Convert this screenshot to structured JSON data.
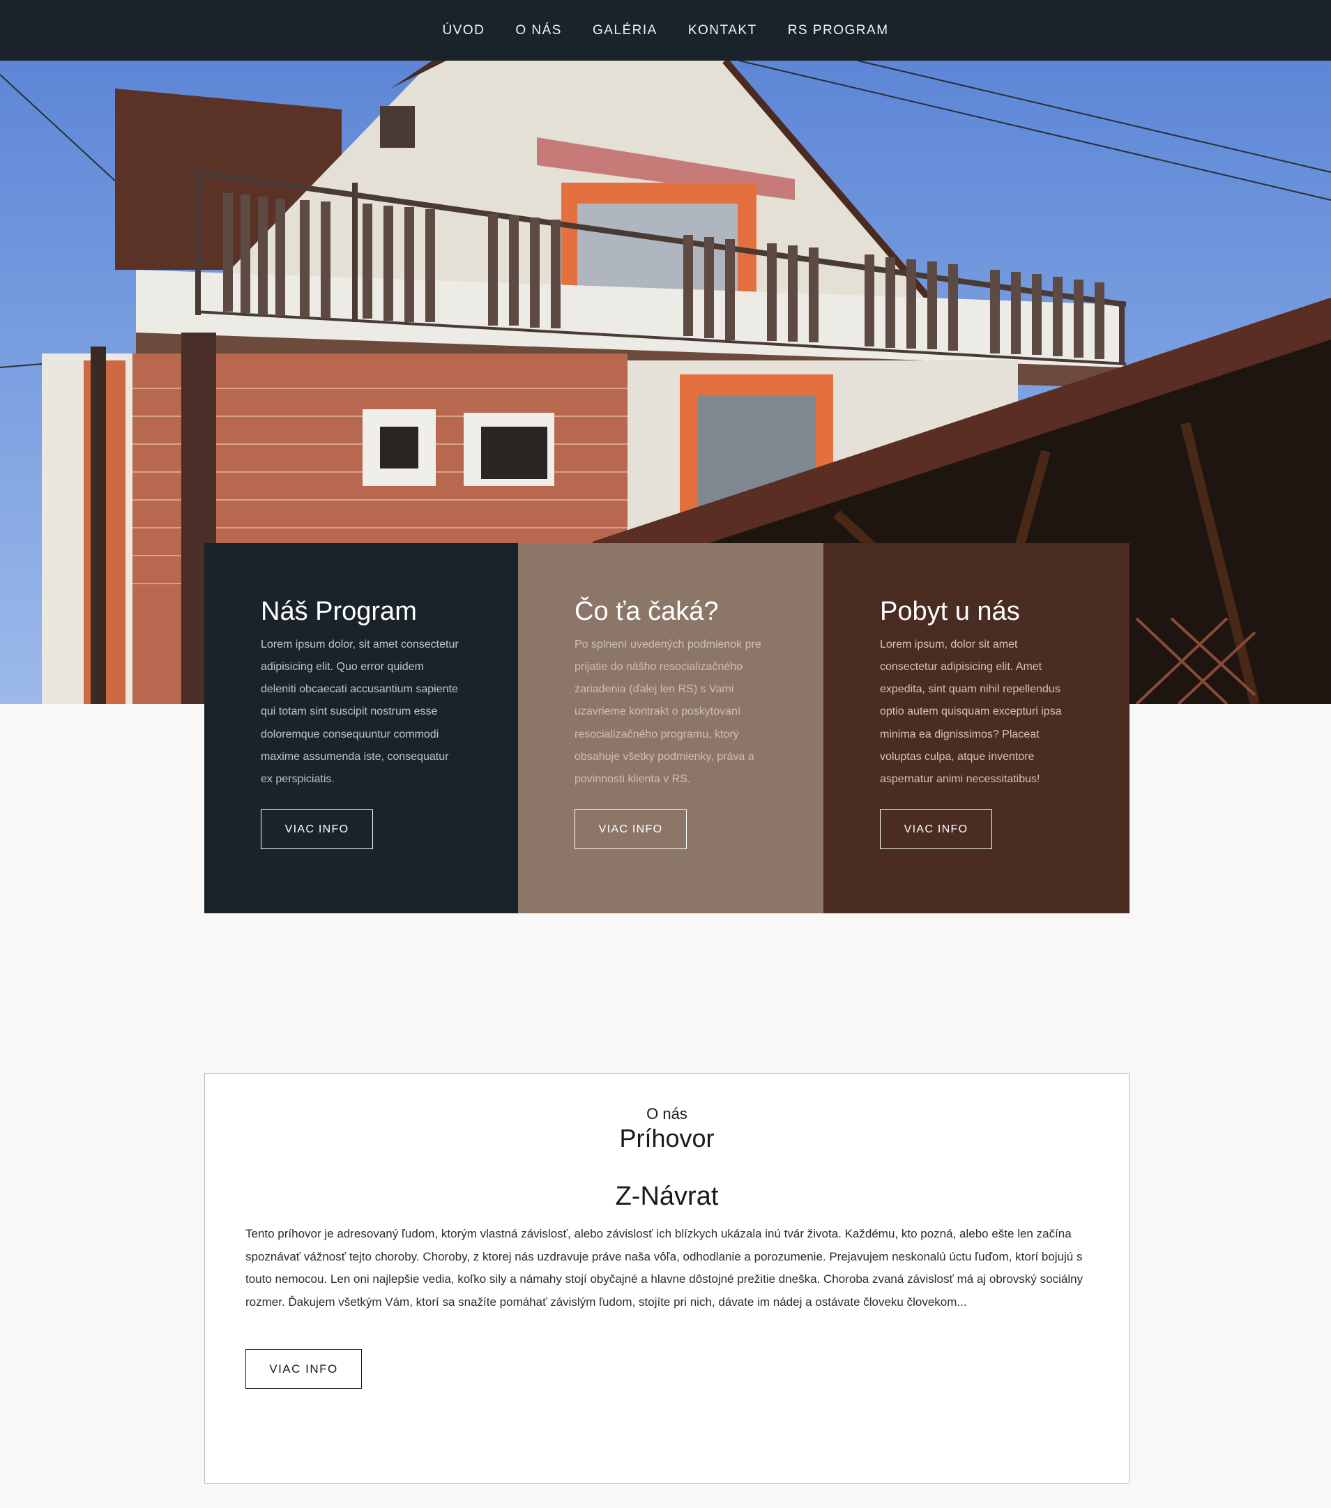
{
  "nav": {
    "items": [
      "ÚVOD",
      "O NÁS",
      "GALÉRIA",
      "KONTAKT",
      "RS PROGRAM"
    ]
  },
  "hero": {
    "image": "house-photo"
  },
  "cards": [
    {
      "title": "Náš Program",
      "text": "Lorem ipsum dolor, sit amet consectetur adipisicing elit. Quo error quidem deleniti obcaecati accusantium sapiente qui totam sint suscipit nostrum esse doloremque consequuntur commodi maxime assumenda iste, consequatur ex perspiciatis.",
      "button": "VIAC INFO"
    },
    {
      "title": "Čo ťa čaká?",
      "text": "Po splnení uvedených podmienok pre prijatie do nášho resocializačného zariadenia (ďalej len RS) s Vami uzavrieme kontrakt o poskytovaní resocializačného programu, ktorý obsahuje všetky podmienky, práva a povinnosti klienta v RS.",
      "button": "VIAC INFO"
    },
    {
      "title": "Pobyt u nás",
      "text": "Lorem ipsum, dolor sit amet consectetur adipisicing elit. Amet expedita, sint quam nihil repellendus optio autem quisquam excepturi ipsa minima ea dignissimos? Placeat voluptas culpa, atque inventore aspernatur animi necessitatibus!",
      "button": "VIAC INFO"
    }
  ],
  "about": {
    "kicker": "O nás",
    "title": "Príhovor",
    "subtitle": "Z-Návrat",
    "text": "Tento príhovor je adresovaný ľudom, ktorým vlastná závislosť, alebo závislosť ich blízkych ukázala inú tvár života. Každému, kto pozná, alebo ešte len začína spoznávať vážnosť tejto choroby. Choroby, z ktorej nás uzdravuje práve naša vôľa, odhodlanie a porozumenie. Prejavujem neskonalú úctu ľuďom, ktorí bojujú s touto nemocou. Len oni najlepšie vedia, koľko sily a námahy stojí obyčajné a hlavne dôstojné prežitie dneška. Choroba zvaná závislosť má aj obrovský sociálny rozmer. Ďakujem všetkým Vám, ktorí sa snažíte pomáhať závislým ľudom, stojíte pri nich, dávate im nádej a ostávate človeku človekom...",
    "button": "VIAC INFO"
  }
}
